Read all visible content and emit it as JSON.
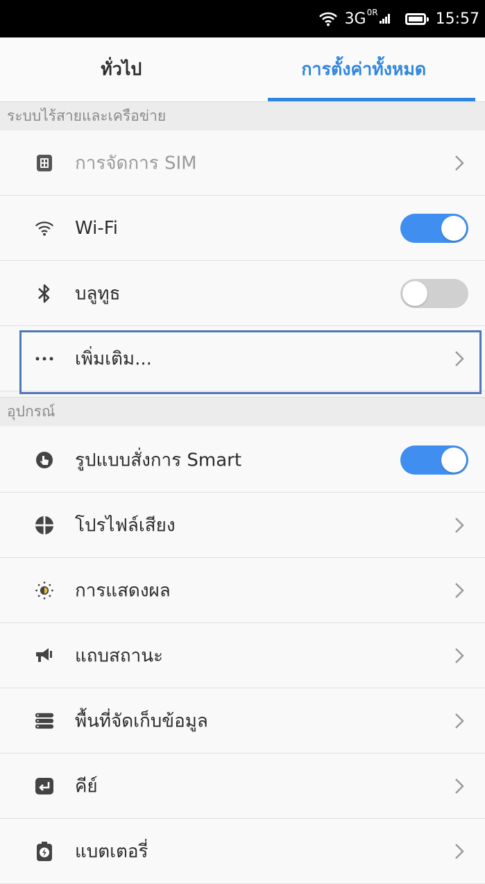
{
  "status_bar": {
    "network": "3G",
    "network_badge": "0R",
    "time": "15:57"
  },
  "tabs": [
    {
      "label": "ทั่วไป",
      "active": false
    },
    {
      "label": "การตั้งค่าทั้งหมด",
      "active": true
    }
  ],
  "sections": {
    "wireless": {
      "header": "ระบบไร้สายและเครือข่าย",
      "items": [
        {
          "label": "การจัดการ SIM",
          "icon": "sim-icon",
          "control": "chevron",
          "enabled": false
        },
        {
          "label": "Wi-Fi",
          "icon": "wifi-icon",
          "control": "toggle",
          "toggle_on": true
        },
        {
          "label": "บลูทูธ",
          "icon": "bluetooth-icon",
          "control": "toggle",
          "toggle_on": false
        },
        {
          "label": "เพิ่มเติม...",
          "icon": "more-icon",
          "control": "chevron",
          "highlighted": true
        }
      ]
    },
    "device": {
      "header": "อุปกรณ์",
      "items": [
        {
          "label": "รูปแบบสั่งการ Smart",
          "icon": "smart-gesture-icon",
          "control": "toggle",
          "toggle_on": true
        },
        {
          "label": "โปรไฟล์เสียง",
          "icon": "sound-profile-icon",
          "control": "chevron"
        },
        {
          "label": "การแสดงผล",
          "icon": "display-brightness-icon",
          "control": "chevron"
        },
        {
          "label": "แถบสถานะ",
          "icon": "status-bar-icon",
          "control": "chevron"
        },
        {
          "label": "พื้นที่จัดเก็บข้อมูล",
          "icon": "storage-icon",
          "control": "chevron"
        },
        {
          "label": "คีย์",
          "icon": "keys-icon",
          "control": "chevron"
        },
        {
          "label": "แบตเตอรี่",
          "icon": "battery-settings-icon",
          "control": "chevron"
        }
      ]
    }
  },
  "colors": {
    "accent": "#2f86e0",
    "toggle_on": "#3f8ef0",
    "toggle_off": "#d0d0d0",
    "highlight_border": "#4f77b6"
  }
}
